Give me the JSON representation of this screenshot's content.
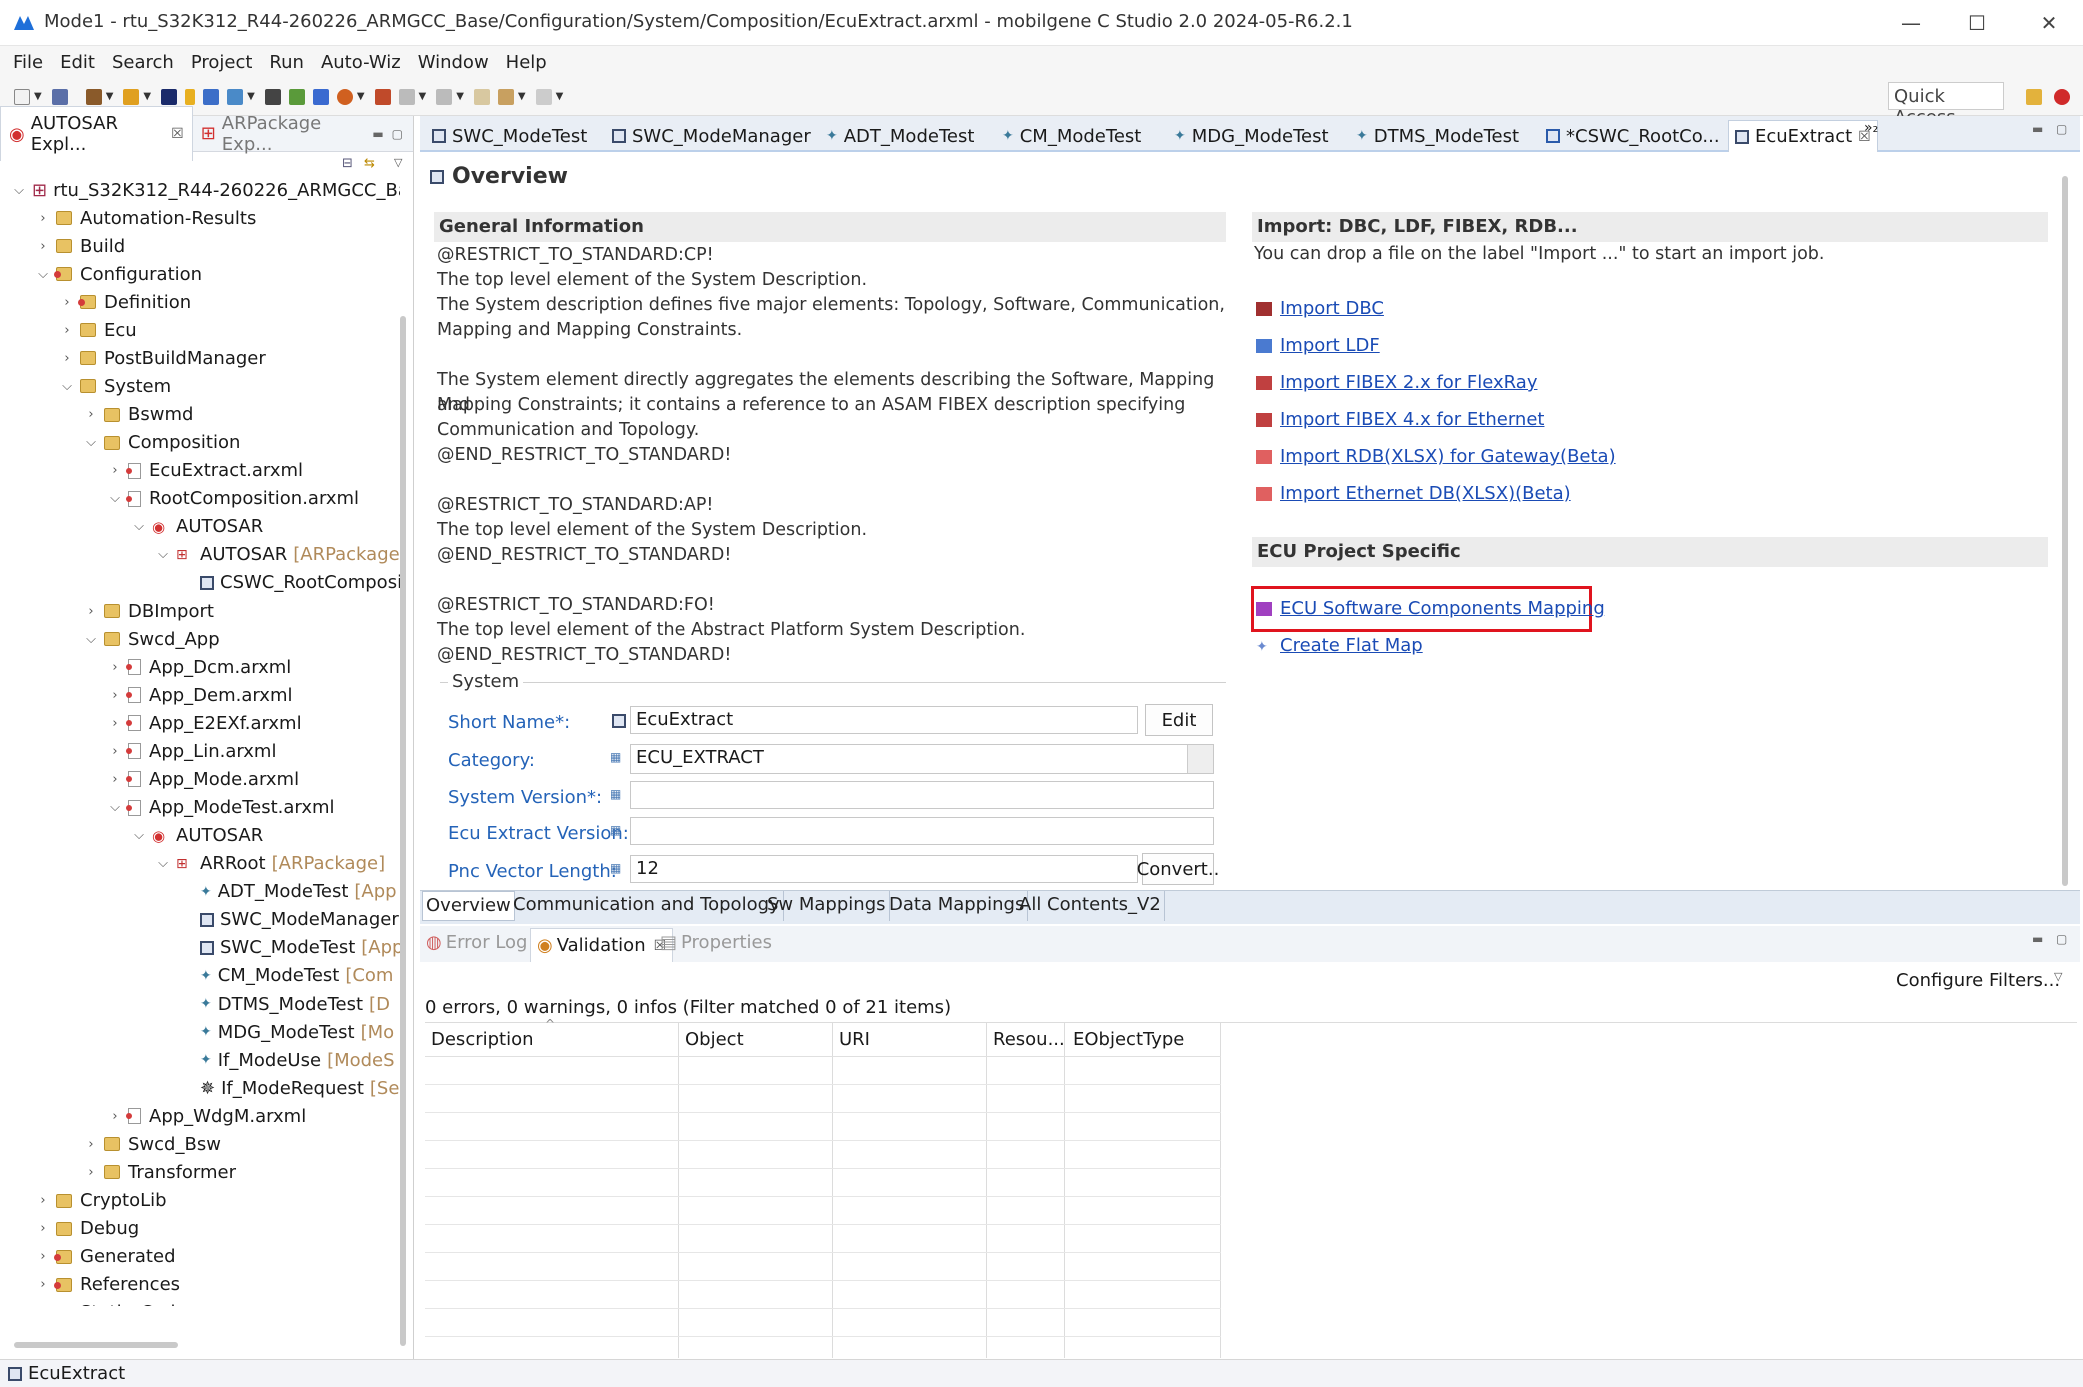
{
  "window": {
    "title": "Mode1 - rtu_S32K312_R44-260226_ARMGCC_Base/Configuration/System/Composition/EcuExtract.arxml - mobilgene C Studio 2.0 2024-05-R6.2.1",
    "minimize": "—",
    "maximize": "☐",
    "close": "✕"
  },
  "menu": [
    "File",
    "Edit",
    "Search",
    "Project",
    "Run",
    "Auto-Wiz",
    "Window",
    "Help"
  ],
  "toolbar": {
    "quick_access": "Quick Access"
  },
  "left_panel": {
    "tabs": [
      {
        "label": "AUTOSAR Expl...",
        "close": "☒"
      },
      {
        "label": "ARPackage Exp..."
      }
    ],
    "tree": [
      {
        "label": "rtu_S32K312_R44-260226_ARMGCC_Base",
        "icon": "project",
        "chev": "v"
      },
      {
        "label": "Automation-Results",
        "icon": "folder",
        "chev": ">"
      },
      {
        "label": "Build",
        "icon": "folder",
        "chev": ">"
      },
      {
        "label": "Configuration",
        "icon": "folder-red",
        "chev": "v"
      },
      {
        "label": "Definition",
        "icon": "folder-red",
        "chev": ">"
      },
      {
        "label": "Ecu",
        "icon": "folder",
        "chev": ">"
      },
      {
        "label": "PostBuildManager",
        "icon": "folder",
        "chev": ">"
      },
      {
        "label": "System",
        "icon": "folder",
        "chev": "v"
      },
      {
        "label": "Bswmd",
        "icon": "folder",
        "chev": ">"
      },
      {
        "label": "Composition",
        "icon": "folder",
        "chev": "v"
      },
      {
        "label": "EcuExtract.arxml",
        "icon": "file",
        "chev": ">"
      },
      {
        "label": "RootComposition.arxml",
        "icon": "file",
        "chev": "v"
      },
      {
        "label": "AUTOSAR",
        "icon": "autosar",
        "chev": "v"
      },
      {
        "label": "AUTOSAR",
        "suffix": "[ARPackage]",
        "icon": "pkg",
        "chev": "v"
      },
      {
        "label": "CSWC_RootComposi",
        "icon": "comp",
        "chev": ""
      },
      {
        "label": "DBImport",
        "icon": "folder",
        "chev": ">"
      },
      {
        "label": "Swcd_App",
        "icon": "folder",
        "chev": "v"
      },
      {
        "label": "App_Dcm.arxml",
        "icon": "file",
        "chev": ">"
      },
      {
        "label": "App_Dem.arxml",
        "icon": "file",
        "chev": ">"
      },
      {
        "label": "App_E2EXf.arxml",
        "icon": "file",
        "chev": ">"
      },
      {
        "label": "App_Lin.arxml",
        "icon": "file",
        "chev": ">"
      },
      {
        "label": "App_Mode.arxml",
        "icon": "file",
        "chev": ">"
      },
      {
        "label": "App_ModeTest.arxml",
        "icon": "file",
        "chev": "v"
      },
      {
        "label": "AUTOSAR",
        "icon": "autosar",
        "chev": "v"
      },
      {
        "label": "ARRoot",
        "suffix": "[ARPackage]",
        "icon": "pkg",
        "chev": "v"
      },
      {
        "label": "ADT_ModeTest",
        "suffix": "[App",
        "icon": "diamond",
        "chev": ""
      },
      {
        "label": "SWC_ModeManager",
        "icon": "swc",
        "chev": ""
      },
      {
        "label": "SWC_ModeTest",
        "suffix": "[App",
        "icon": "swc",
        "chev": ""
      },
      {
        "label": "CM_ModeTest",
        "suffix": "[Com",
        "icon": "diamond",
        "chev": ""
      },
      {
        "label": "DTMS_ModeTest",
        "suffix": "[D",
        "icon": "diamond",
        "chev": ""
      },
      {
        "label": "MDG_ModeTest",
        "suffix": "[Mo",
        "icon": "diamond",
        "chev": ""
      },
      {
        "label": "If_ModeUse",
        "suffix": "[ModeS",
        "icon": "diamond",
        "chev": ""
      },
      {
        "label": "If_ModeRequest",
        "suffix": "[Se",
        "icon": "iface",
        "chev": ""
      },
      {
        "label": "App_WdgM.arxml",
        "icon": "file",
        "chev": ">"
      },
      {
        "label": "Swcd_Bsw",
        "icon": "folder",
        "chev": ">"
      },
      {
        "label": "Transformer",
        "icon": "folder",
        "chev": ">"
      },
      {
        "label": "CryptoLib",
        "icon": "folder",
        "chev": ">"
      },
      {
        "label": "Debug",
        "icon": "folder",
        "chev": ">"
      },
      {
        "label": "Generated",
        "icon": "folder-red",
        "chev": ">"
      },
      {
        "label": "References",
        "icon": "folder-red",
        "chev": ">"
      },
      {
        "label": "Static_Code",
        "icon": "folder-red",
        "chev": ">"
      }
    ]
  },
  "editor": {
    "tabs": [
      {
        "label": "SWC_ModeTest"
      },
      {
        "label": "SWC_ModeManager"
      },
      {
        "label": "ADT_ModeTest"
      },
      {
        "label": "CM_ModeTest"
      },
      {
        "label": "MDG_ModeTest"
      },
      {
        "label": "DTMS_ModeTest"
      },
      {
        "label": "*CSWC_RootCo..."
      },
      {
        "label": "EcuExtract",
        "close": "☒"
      }
    ],
    "overflow": "»₂",
    "page_title": "Overview",
    "general_info": {
      "heading": "General Information",
      "lines": [
        "@RESTRICT_TO_STANDARD:CP!",
        "The top level element of the System Description.",
        "The System description defines five major elements: Topology, Software, Communication,",
        "Mapping and Mapping Constraints.",
        "",
        "The System element directly aggregates the elements describing the Software, Mapping and",
        "Mapping Constraints; it contains a reference to an ASAM FIBEX description specifying",
        "Communication and Topology.",
        "@END_RESTRICT_TO_STANDARD!",
        "",
        "@RESTRICT_TO_STANDARD:AP!",
        "The top level element of the System Description.",
        "@END_RESTRICT_TO_STANDARD!",
        "",
        "@RESTRICT_TO_STANDARD:FO!",
        "The top level element of the Abstract Platform System Description.",
        "@END_RESTRICT_TO_STANDARD!"
      ]
    },
    "system_form": {
      "group_label": "System",
      "short_name": {
        "label": "Short Name*:",
        "value": "EcuExtract",
        "button": "Edit"
      },
      "category": {
        "label": "Category:",
        "value": "ECU_EXTRACT"
      },
      "system_version": {
        "label": "System Version*:",
        "value": ""
      },
      "ecu_extract_version": {
        "label": "Ecu Extract Version:",
        "value": ""
      },
      "pnc_vector_length": {
        "label": "Pnc Vector Length:",
        "value": "12",
        "button": "Convert.."
      }
    },
    "import": {
      "heading": "Import: DBC, LDF, FIBEX, RDB...",
      "hint": "You can drop a file on the label \"Import ...\" to start an import job.",
      "links": [
        "Import DBC",
        "Import LDF",
        "Import FIBEX 2.x for FlexRay",
        "Import FIBEX 4.x for Ethernet",
        "Import RDB(XLSX) for Gateway(Beta)",
        "Import Ethernet DB(XLSX)(Beta)"
      ]
    },
    "ecu_specific": {
      "heading": "ECU Project Specific",
      "links": [
        "ECU Software Components Mapping",
        "Create Flat Map"
      ]
    },
    "bottom_tabs": [
      "Overview",
      "Communication and Topology",
      "Sw Mappings",
      "Data Mappings",
      "All Contents_V2"
    ]
  },
  "validation": {
    "tabs": [
      {
        "label": "Error Log"
      },
      {
        "label": "Validation",
        "close": "☒"
      },
      {
        "label": "Properties"
      }
    ],
    "configure": "Configure Filters...",
    "summary": "0 errors, 0 warnings, 0 infos (Filter matched 0 of 21 items)",
    "columns": [
      "Description",
      "Object",
      "URI",
      "Resou...",
      "EObjectType"
    ]
  },
  "status": {
    "text": "EcuExtract"
  },
  "colors": {
    "highlight": "#e0141e",
    "link": "#1a4bb5",
    "label": "#2463b8"
  }
}
